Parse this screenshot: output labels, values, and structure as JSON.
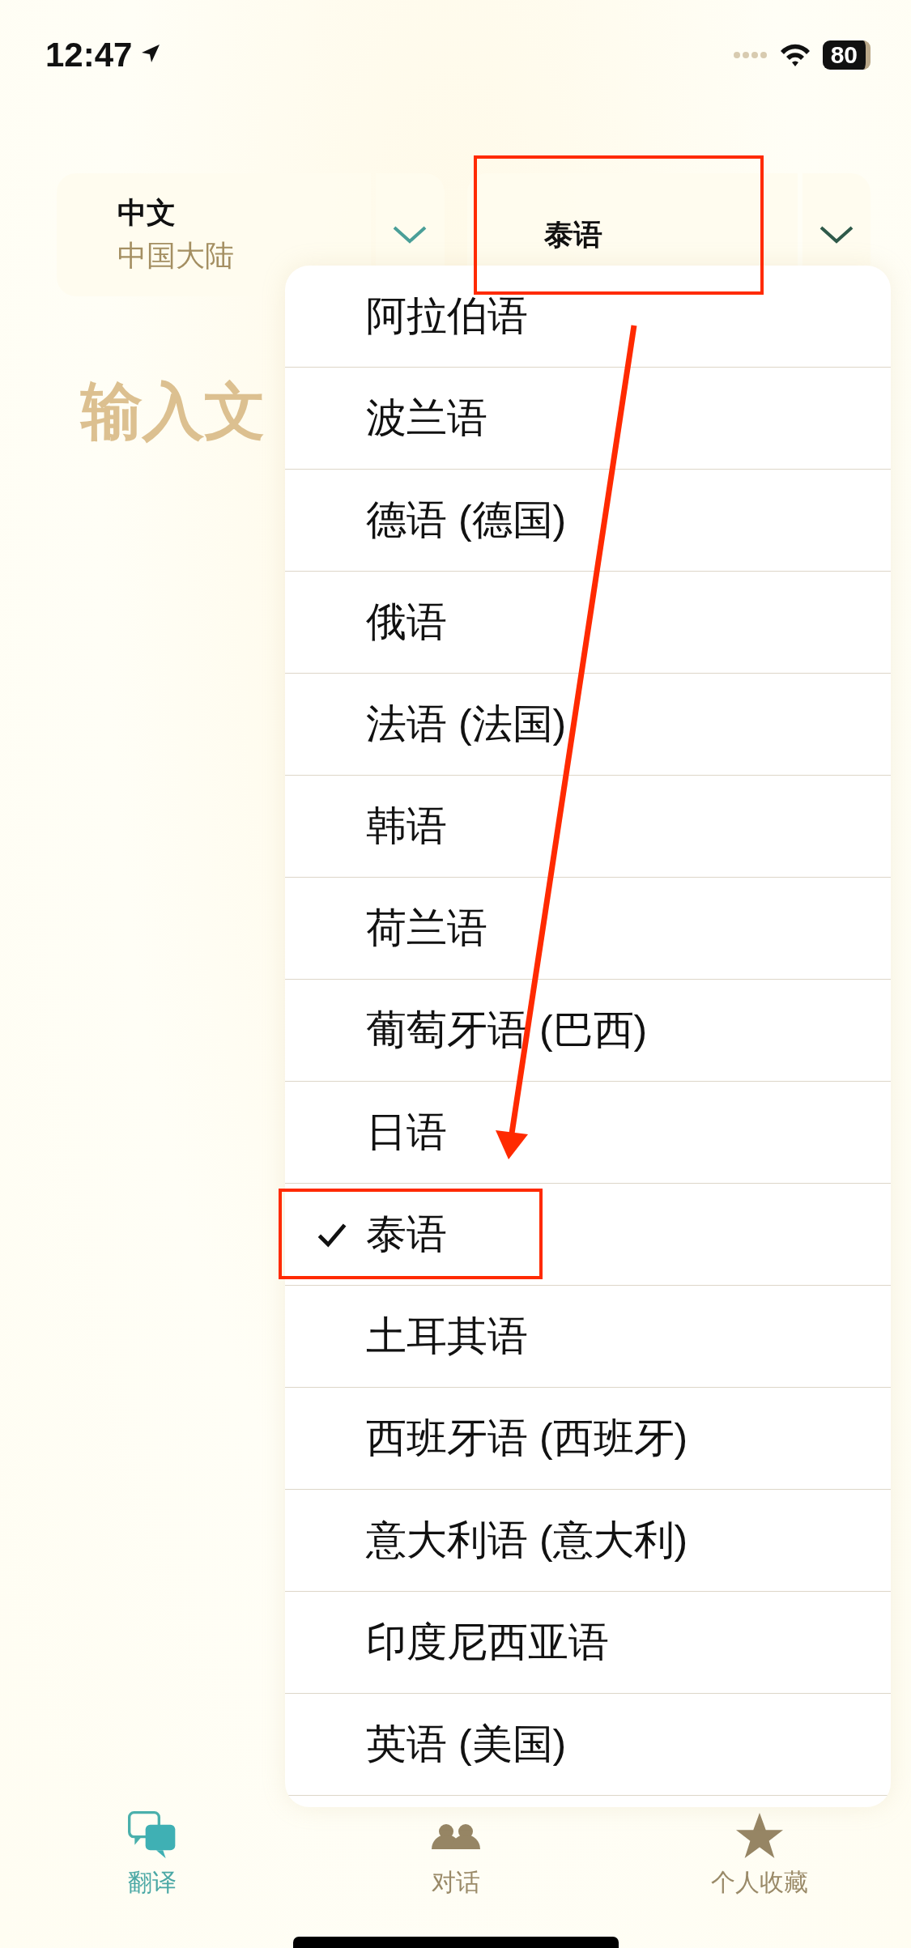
{
  "status_bar": {
    "time": "12:47",
    "battery": "80"
  },
  "source_language": {
    "name": "中文",
    "region": "中国大陆"
  },
  "target_language": {
    "name": "泰语",
    "highlighted": true
  },
  "input": {
    "placeholder": "输入文"
  },
  "language_menu": {
    "items": [
      {
        "label": "阿拉伯语",
        "selected": false
      },
      {
        "label": "波兰语",
        "selected": false
      },
      {
        "label": "德语 (德国)",
        "selected": false
      },
      {
        "label": "俄语",
        "selected": false
      },
      {
        "label": "法语 (法国)",
        "selected": false
      },
      {
        "label": "韩语",
        "selected": false
      },
      {
        "label": "荷兰语",
        "selected": false
      },
      {
        "label": "葡萄牙语 (巴西)",
        "selected": false
      },
      {
        "label": "日语",
        "selected": false
      },
      {
        "label": "泰语",
        "selected": true,
        "highlighted": true
      },
      {
        "label": "土耳其语",
        "selected": false
      },
      {
        "label": "西班牙语 (西班牙)",
        "selected": false
      },
      {
        "label": "意大利语 (意大利)",
        "selected": false
      },
      {
        "label": "印度尼西亚语",
        "selected": false
      },
      {
        "label": "英语 (美国)",
        "selected": false
      }
    ]
  },
  "annotation_arrow": true,
  "tab_bar": [
    {
      "kind": "translate",
      "label": "翻译",
      "selected": true
    },
    {
      "kind": "conversation",
      "label": "对话",
      "selected": false
    },
    {
      "kind": "favorites",
      "label": "个人收藏",
      "selected": false
    }
  ]
}
